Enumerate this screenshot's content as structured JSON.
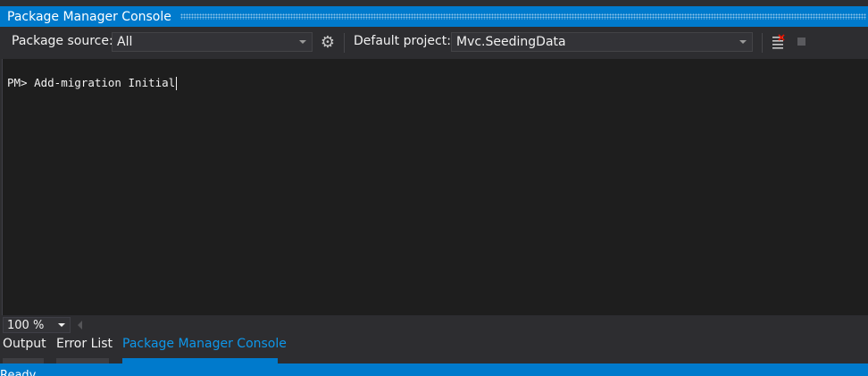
{
  "window": {
    "title": "Package Manager Console"
  },
  "toolbar": {
    "package_source_label": "Package source:",
    "package_source_value": "All",
    "default_project_label": "Default project:",
    "default_project_value": "Mvc.SeedingData",
    "settings_icon": "gear-icon",
    "clear_icon": "clear-console-icon",
    "stop_icon": "stop-icon"
  },
  "console": {
    "prompt": "PM>",
    "command": "Add-migration Initial"
  },
  "zoom": {
    "value": "100 %"
  },
  "tabs": [
    {
      "label": "Output",
      "active": false
    },
    {
      "label": "Error List",
      "active": false
    },
    {
      "label": "Package Manager Console",
      "active": true
    }
  ],
  "status": {
    "text": "Ready"
  },
  "colors": {
    "accent": "#007acc",
    "background": "#2d2d30",
    "console_bg": "#1e1e1e"
  }
}
